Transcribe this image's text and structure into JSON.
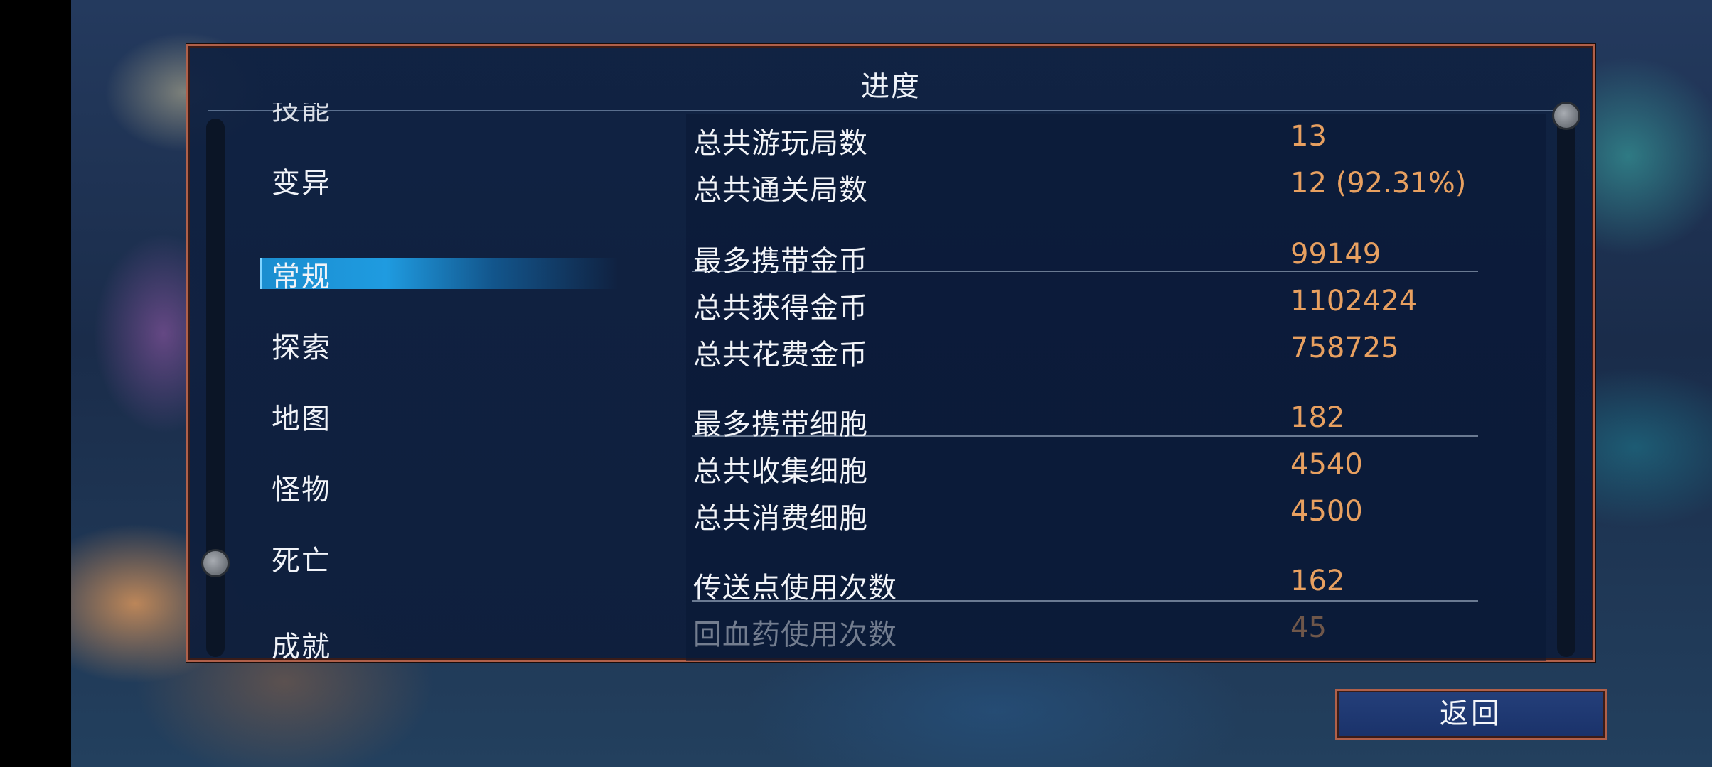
{
  "panel": {
    "title": "进度"
  },
  "menu": {
    "items": [
      {
        "label": "技能"
      },
      {
        "label": "变异"
      },
      {
        "label": "常规"
      },
      {
        "label": "探索"
      },
      {
        "label": "地图"
      },
      {
        "label": "怪物"
      },
      {
        "label": "死亡"
      },
      {
        "label": "成就"
      }
    ],
    "selected": "常规"
  },
  "stats": {
    "rows": [
      {
        "label": "总共游玩局数",
        "value": "13"
      },
      {
        "label": "总共通关局数",
        "value": "12 (92.31%)"
      },
      {
        "label": "最多携带金币",
        "value": "99149"
      },
      {
        "label": "总共获得金币",
        "value": "1102424"
      },
      {
        "label": "总共花费金币",
        "value": "758725"
      },
      {
        "label": "最多携带细胞",
        "value": "182"
      },
      {
        "label": "总共收集细胞",
        "value": "4540"
      },
      {
        "label": "总共消费细胞",
        "value": "4500"
      },
      {
        "label": "传送点使用次数",
        "value": "162"
      },
      {
        "label": "回血药使用次数",
        "value": "45"
      }
    ]
  },
  "footer": {
    "back_label": "返回"
  },
  "colors": {
    "value_text": "#e8a060",
    "panel_border": "#b0604a",
    "highlight": "#1f9be0",
    "panel_bg": "#10224a"
  }
}
